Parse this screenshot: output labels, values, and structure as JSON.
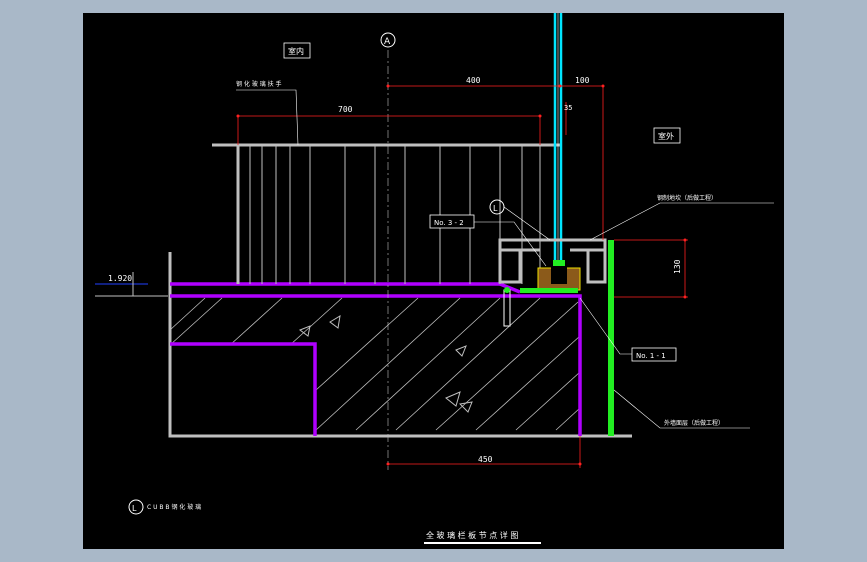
{
  "drawing": {
    "title_text": "全 玻 璃 栏 板 节 点 详 图",
    "label_indoor": "室内",
    "label_outdoor": "室外",
    "label_rail_top": "钢 化 玻 璃 扶 手",
    "label_steel_channel": "钢制地坎（后做工程）",
    "label_exterior_wall": "外墙面层（后做工程）",
    "label_elevation": "1.920",
    "tag_no3": "No. 3 - 2",
    "tag_no1": "No. 1 - 1",
    "circle_top": "L",
    "circle_bottom": "L",
    "legend_note": "C U B B 钢 化 玻 璃",
    "dim_400": "400",
    "dim_100": "100",
    "dim_700": "700",
    "dim_35": "35",
    "dim_130": "130",
    "dim_450": "450",
    "axis_label": "A"
  },
  "colors": {
    "background_outer": "#a9b8c8",
    "canvas": "#000000",
    "glass": "#00e5ff",
    "purple": "#b000ff",
    "green": "#22ee22",
    "dim_red": "#ff2020",
    "gray": "#bfbfbf",
    "bracket": "#8b5a1a",
    "yellow": "#f0e000"
  }
}
